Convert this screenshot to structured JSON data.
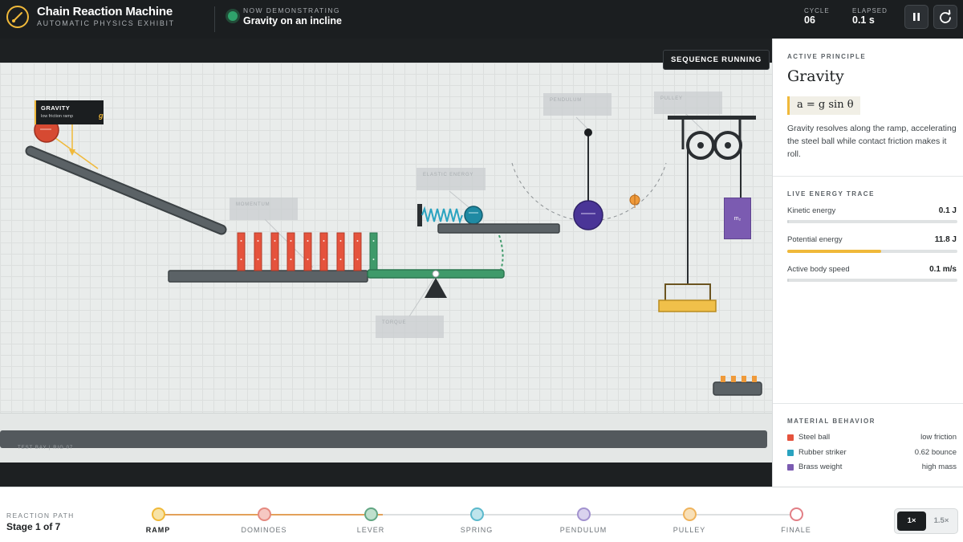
{
  "app": {
    "title": "Chain Reaction Machine",
    "subtitle": "AUTOMATIC PHYSICS EXHIBIT"
  },
  "header": {
    "now_label": "NOW DEMONSTRATING",
    "now_value": "Gravity on an incline",
    "cycle_label": "CYCLE",
    "cycle_value": "06",
    "elapsed_label": "ELAPSED",
    "elapsed_value": "0.1 s",
    "pause_icon": "pause-icon",
    "restart_icon": "restart-icon"
  },
  "stage": {
    "status_badge": "SEQUENCE RUNNING",
    "tooltip_title": "GRAVITY",
    "tooltip_subtitle": "low friction ramp",
    "tooltip_symbol": "g",
    "ghost_labels": [
      "MOMENTUM",
      "ELASTIC ENERGY",
      "PENDULUM",
      "PULLEY",
      "TORQUE"
    ],
    "mass_label": "m₂",
    "floor_caption": "TEST BAY  |  RIG 07"
  },
  "panel": {
    "principle_section": "ACTIVE PRINCIPLE",
    "principle_name": "Gravity",
    "formula": "a = g sin θ",
    "description": "Gravity resolves along the ramp, accelerating the steel ball while contact friction makes it roll.",
    "energy_section": "LIVE ENERGY TRACE",
    "meters": [
      {
        "label": "Kinetic energy",
        "value": "0.1 J",
        "fraction": 0.01,
        "color": "#cfd3d5"
      },
      {
        "label": "Potential energy",
        "value": "11.8 J",
        "fraction": 0.55,
        "color": "#f0b93a"
      },
      {
        "label": "Active body speed",
        "value": "0.1 m/s",
        "fraction": 0.01,
        "color": "#cfd3d5"
      }
    ],
    "material_section": "MATERIAL BEHAVIOR",
    "materials": [
      {
        "name": "Steel ball",
        "property": "low friction",
        "color": "#e5533d"
      },
      {
        "name": "Rubber striker",
        "property": "0.62 bounce",
        "color": "#2aa3c0"
      },
      {
        "name": "Brass weight",
        "property": "high mass",
        "color": "#7b5bb1"
      }
    ]
  },
  "footer": {
    "path_label": "REACTION PATH",
    "stage_text": "Stage 1 of 7",
    "steps": [
      {
        "label": "RAMP",
        "color": "#f0b93a",
        "fill": "#f7e3a6"
      },
      {
        "label": "DOMINOES",
        "color": "#e58a80",
        "fill": "#f6c8c2"
      },
      {
        "label": "LEVER",
        "color": "#62a683",
        "fill": "#bfe0cd"
      },
      {
        "label": "SPRING",
        "color": "#5cb9cc",
        "fill": "#bfe5ec"
      },
      {
        "label": "PENDULUM",
        "color": "#a292cf",
        "fill": "#d9d2ee"
      },
      {
        "label": "PULLEY",
        "color": "#efb35c",
        "fill": "#f8e0b8"
      },
      {
        "label": "FINALE",
        "color": "#e27f86",
        "fill": "#ffffff"
      }
    ],
    "speed_options": [
      "1×",
      "1.5×"
    ],
    "speed_selected": "1×"
  },
  "colors": {
    "accent": "#f0b93a",
    "dark": "#1b1e20",
    "domino": "#e5533d",
    "lever": "#3f9a6a",
    "spring": "#2aa3c0",
    "weight": "#7b5bb1"
  }
}
